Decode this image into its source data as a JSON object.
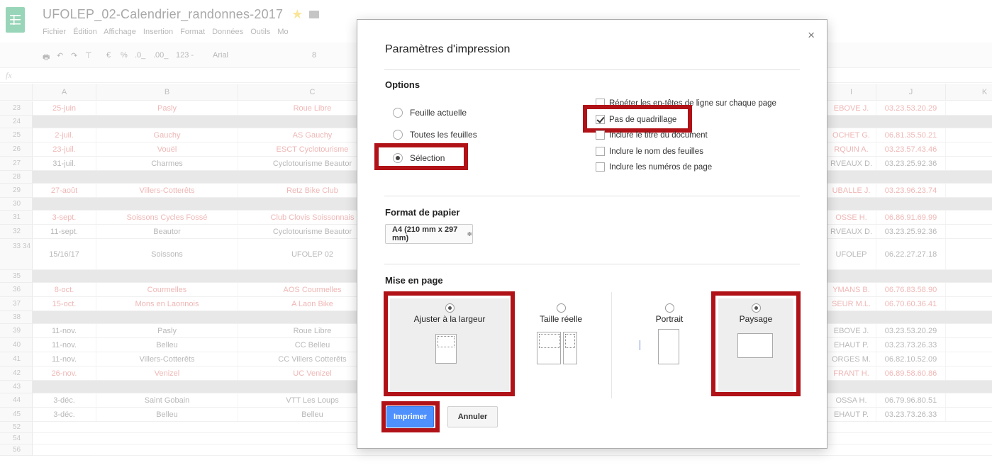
{
  "app": {
    "title": "UFOLEP_02-Calendrier_randonnes-2017",
    "menu": [
      "Fichier",
      "Édition",
      "Affichage",
      "Insertion",
      "Format",
      "Données",
      "Outils",
      "Mo"
    ],
    "toolbar": {
      "currency": "€",
      "percent": "%",
      "dec_less": ".0_",
      ".00_": ".00_",
      "format_123": "123 -",
      "font": "Arial",
      "size": "8"
    },
    "fx": "fx",
    "columns": [
      "A",
      "B",
      "C",
      "I",
      "J",
      "K"
    ],
    "rows": [
      {
        "n": "23",
        "a": "25-juin",
        "b": "Pasly",
        "c": "Roue Libre",
        "i": "EBOVE J.",
        "j": "03.23.53.20.29",
        "color": "red"
      },
      {
        "n": "24",
        "sep": true
      },
      {
        "n": "25",
        "a": "2-juil.",
        "b": "Gauchy",
        "c": "AS Gauchy",
        "i": "OCHET G.",
        "j": "06.81.35.50.21",
        "color": "red"
      },
      {
        "n": "26",
        "a": "23-juil.",
        "b": "Vouël",
        "c": "ESCT Cyclotourisme",
        "i": "RQUIN A.",
        "j": "03.23.57.43.46",
        "color": "red"
      },
      {
        "n": "27",
        "a": "31-juil.",
        "b": "Charmes",
        "c": "Cyclotourisme Beautor",
        "i": "RVEAUX D.",
        "j": "03.23.25.92.36",
        "color": "gray"
      },
      {
        "n": "28",
        "sep": true
      },
      {
        "n": "29",
        "a": "27-août",
        "b": "Villers-Cotterêts",
        "c": "Retz Bike Club",
        "i": "UBALLE J.",
        "j": "03.23.96.23.74",
        "color": "red"
      },
      {
        "n": "30",
        "sep": true
      },
      {
        "n": "31",
        "a": "3-sept.",
        "b": "Soissons Cycles Fossé",
        "c": "Club Clovis Soissonnais",
        "i": "OSSE H.",
        "j": "06.86.91.69.99",
        "color": "red"
      },
      {
        "n": "32",
        "a": "11-sept.",
        "b": "Beautor",
        "c": "Cyclotourisme Beautor",
        "i": "RVEAUX D.",
        "j": "03.23.25.92.36",
        "color": "gray"
      },
      {
        "n": "33 34",
        "a": "15/16/17",
        "b": "Soissons",
        "c": "UFOLEP 02",
        "i": "UFOLEP",
        "j": "06.22.27.27.18",
        "color": "gray",
        "tall": true
      },
      {
        "n": "35",
        "sep": true
      },
      {
        "n": "36",
        "a": "8-oct.",
        "b": "Courmelles",
        "c": "AOS Courmelles",
        "i": "YMANS B.",
        "j": "06.76.83.58.90",
        "color": "red"
      },
      {
        "n": "37",
        "a": "15-oct.",
        "b": "Mons en Laonnois",
        "c": "A Laon Bike",
        "i": "SEUR M.L.",
        "j": "06.70.60.36.41",
        "color": "red"
      },
      {
        "n": "38",
        "sep": true
      },
      {
        "n": "39",
        "a": "11-nov.",
        "b": "Pasly",
        "c": "Roue Libre",
        "i": "EBOVE J.",
        "j": "03.23.53.20.29",
        "color": "gray"
      },
      {
        "n": "40",
        "a": "11-nov.",
        "b": "Belleu",
        "c": "CC Belleu",
        "i": "EHAUT P.",
        "j": "03.23.73.26.33",
        "color": "gray"
      },
      {
        "n": "41",
        "a": "11-nov.",
        "b": "Villers-Cotterêts",
        "c": "CC Villers Cotterêts",
        "i": "ORGES M.",
        "j": "06.82.10.52.09",
        "color": "gray"
      },
      {
        "n": "42",
        "a": "26-nov.",
        "b": "Venizel",
        "c": "UC Venizel",
        "i": "FRANT H.",
        "j": "06.89.58.60.86",
        "color": "red"
      },
      {
        "n": "43",
        "sep": true
      },
      {
        "n": "44",
        "a": "3-déc.",
        "b": "Saint Gobain",
        "c": "VTT Les Loups",
        "i": "OSSA H.",
        "j": "06.79.96.80.51",
        "color": "gray"
      },
      {
        "n": "45",
        "a": "3-déc.",
        "b": "Belleu",
        "c": "Belleu",
        "i": "EHAUT P.",
        "j": "03.23.73.26.33",
        "color": "gray"
      },
      {
        "n": "52",
        "blank": true
      },
      {
        "n": "54",
        "blank": true
      },
      {
        "n": "56",
        "blank": true
      }
    ]
  },
  "dialog": {
    "title": "Paramètres d'impression",
    "close": "×",
    "options": {
      "heading": "Options",
      "radios": [
        {
          "label": "Feuille actuelle",
          "checked": false
        },
        {
          "label": "Toutes les feuilles",
          "checked": false
        },
        {
          "label": "Sélection",
          "checked": true
        }
      ],
      "checkboxes": [
        {
          "label": "Répéter les en-têtes de ligne sur chaque page",
          "checked": false
        },
        {
          "label": "Pas de quadrillage",
          "checked": true
        },
        {
          "label": "Inclure le titre du document",
          "checked": false
        },
        {
          "label": "Inclure le nom des feuilles",
          "checked": false
        },
        {
          "label": "Inclure les numéros de page",
          "checked": false
        }
      ]
    },
    "paper": {
      "heading": "Format de papier",
      "value": "A4 (210 mm x 297 mm)",
      "arrow": "≑"
    },
    "layout": {
      "heading": "Mise en page",
      "fit_width": {
        "label": "Ajuster à la largeur",
        "checked": true
      },
      "actual_size": {
        "label": "Taille réelle",
        "checked": false
      },
      "portrait": {
        "label": "Portrait",
        "checked": false
      },
      "landscape": {
        "label": "Paysage",
        "checked": true
      }
    },
    "buttons": {
      "print": "Imprimer",
      "cancel": "Annuler"
    },
    "highlight_color": "#b01217",
    "primary_color": "#4d90fe"
  }
}
